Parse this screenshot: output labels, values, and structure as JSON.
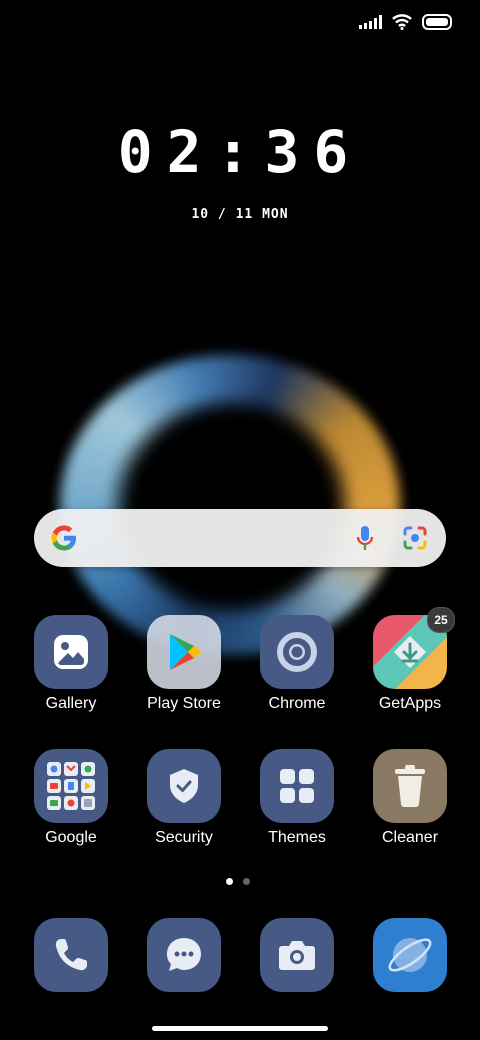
{
  "status_bar": {
    "icons": [
      "signal-icon",
      "wifi-icon",
      "battery-icon"
    ]
  },
  "clock": {
    "time": "02:36",
    "date": "10 / 11 MON"
  },
  "search": {
    "icons": [
      "google-logo",
      "mic-icon",
      "lens-icon"
    ]
  },
  "apps": [
    {
      "label": "Gallery",
      "icon": "gallery-icon"
    },
    {
      "label": "Play Store",
      "icon": "play-store-icon"
    },
    {
      "label": "Chrome",
      "icon": "chrome-icon"
    },
    {
      "label": "GetApps",
      "icon": "getapps-icon",
      "badge": "25"
    },
    {
      "label": "Google",
      "icon": "google-folder-icon"
    },
    {
      "label": "Security",
      "icon": "security-icon"
    },
    {
      "label": "Themes",
      "icon": "themes-icon"
    },
    {
      "label": "Cleaner",
      "icon": "cleaner-icon"
    }
  ],
  "dock": [
    {
      "icon": "phone-icon"
    },
    {
      "icon": "messages-icon"
    },
    {
      "icon": "camera-icon"
    },
    {
      "icon": "browser-icon"
    }
  ],
  "page_indicator": {
    "pages": 2,
    "current": 1
  },
  "colors": {
    "tile": "#475985",
    "background": "#000000"
  }
}
